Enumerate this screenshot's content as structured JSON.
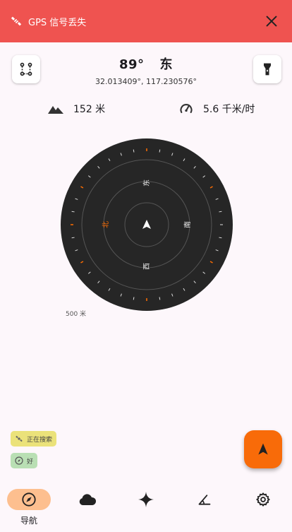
{
  "banner": {
    "message": "GPS 信号丢失",
    "color": "#ef5350",
    "icons": [
      "satellite-icon",
      "close-icon"
    ]
  },
  "header": {
    "heading_degrees": "89°",
    "heading_direction": "东",
    "coordinates": "32.013409°, 117.230576°",
    "left_button_icon": "route-icon",
    "right_button_icon": "flashlight-icon"
  },
  "stats": {
    "altitude": "152 米",
    "speed": "5.6 千米/时"
  },
  "compass": {
    "cardinals": {
      "north": "北",
      "east": "东",
      "south": "南",
      "west": "西"
    },
    "scale_label": "500 米",
    "accent": "#ff6d00"
  },
  "status": {
    "gps_label": "正在搜索",
    "accuracy_label": "好"
  },
  "fab": {
    "icon": "navigation-arrow-icon",
    "color": "#f86b09"
  },
  "nav": {
    "items": [
      {
        "label": "导航",
        "icon": "compass-icon",
        "active": true
      },
      {
        "label": "",
        "icon": "cloud-icon",
        "active": false
      },
      {
        "label": "",
        "icon": "star-icon",
        "active": false
      },
      {
        "label": "",
        "icon": "angle-icon",
        "active": false
      },
      {
        "label": "",
        "icon": "gear-icon",
        "active": false
      }
    ]
  }
}
